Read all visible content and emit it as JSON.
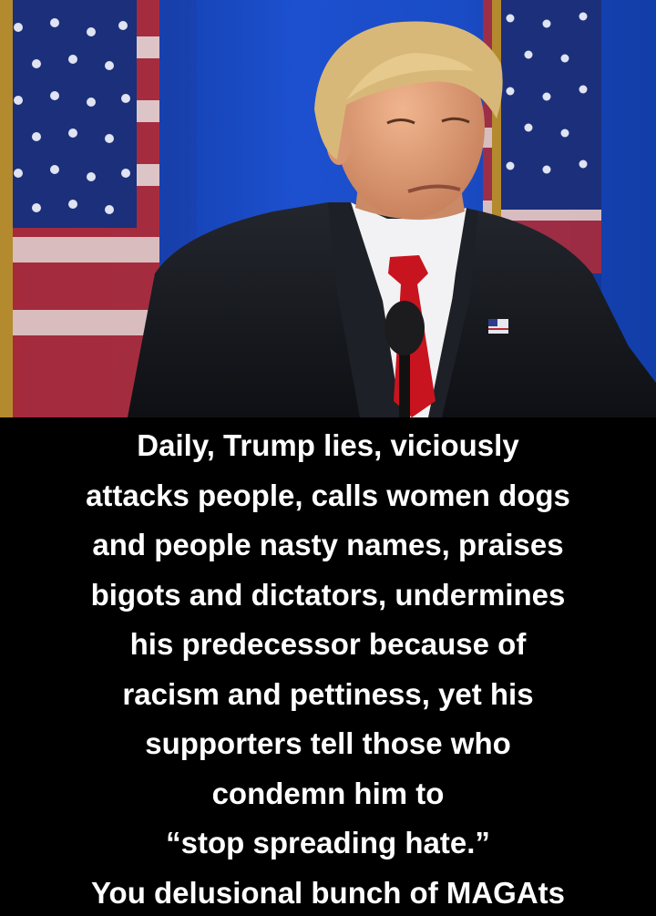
{
  "photo": {
    "description_icon": "portrait-photo",
    "colors": {
      "background": "#1747c0",
      "flag_red": "#b52a33",
      "flag_white": "#e8e6e6",
      "flag_blue": "#1b2f7a",
      "suit": "#15171c",
      "tie": "#c8141f",
      "skin": "#e2a07a",
      "hair": "#d8b878"
    }
  },
  "caption": {
    "lines": [
      "Daily, Trump lies, viciously",
      "attacks people, calls women dogs",
      "and people nasty names, praises",
      "bigots and dictators, undermines",
      "his predecessor because of",
      "racism and pettiness, yet his",
      "supporters tell those who",
      "condemn him to",
      "“stop spreading hate.”",
      "You delusional bunch of MAGAts"
    ],
    "text_color": "#ffffff",
    "background_color": "#000000"
  }
}
